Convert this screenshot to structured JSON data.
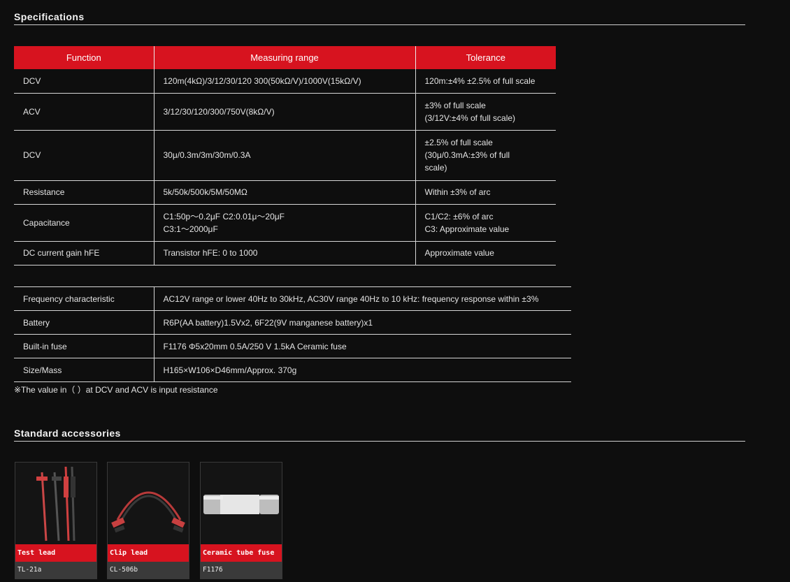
{
  "specs": {
    "title": "Specifications",
    "headers": [
      "Function",
      "Measuring range",
      "Tolerance"
    ],
    "rows": [
      {
        "function": "DCV",
        "range": "120m(4kΩ)/3/12/30/120 300(50kΩ/V)/1000V(15kΩ/V)",
        "tolerance": "120m:±4% ±2.5% of full scale"
      },
      {
        "function": "ACV",
        "range": "3/12/30/120/300/750V(8kΩ/V)",
        "tolerance": "±3% of full scale\n(3/12V:±4% of full scale)"
      },
      {
        "function": "DCV",
        "range": "30μ/0.3m/3m/30m/0.3A",
        "tolerance": "±2.5% of full scale\n(30μ/0.3mA:±3% of full\nscale)"
      },
      {
        "function": "Resistance",
        "range": "5k/50k/500k/5M/50MΩ",
        "tolerance": "Within ±3% of arc"
      },
      {
        "function": "Capacitance",
        "range": "C1:50p〜0.2μF C2:0.01μ〜20μF\nC3:1〜2000μF",
        "tolerance": "C1/C2: ±6% of arc\nC3: Approximate value"
      },
      {
        "function": "DC current gain hFE",
        "range": "Transistor hFE: 0 to 1000",
        "tolerance": "Approximate value"
      }
    ],
    "misc": [
      {
        "label": "Frequency characteristic",
        "value": "AC12V range or lower 40Hz to 30kHz, AC30V range 40Hz to 10 kHz: frequency response within ±3%"
      },
      {
        "label": "Battery",
        "value": "R6P(AA battery)1.5Vx2, 6F22(9V manganese battery)x1"
      },
      {
        "label": "Built-in fuse",
        "value": "F1176 Φ5x20mm 0.5A/250 V 1.5kA Ceramic fuse"
      },
      {
        "label": "Size/Mass",
        "value": "H165×W106×D46mm/Approx. 370g"
      }
    ],
    "note": "※The value in（ ）at DCV and ACV is input resistance"
  },
  "accessories": {
    "title": "Standard accessories",
    "items": [
      {
        "name": "Test lead",
        "code": "TL-21a",
        "icon": "test-lead-icon"
      },
      {
        "name": "Clip lead",
        "code": "CL-506b",
        "icon": "clip-lead-icon"
      },
      {
        "name": "Ceramic tube fuse",
        "code": "F1176",
        "icon": "ceramic-fuse-icon"
      }
    ]
  },
  "colors": {
    "accent": "#d7131f",
    "background": "#0e0e0e",
    "rule": "#d6d6d6"
  }
}
